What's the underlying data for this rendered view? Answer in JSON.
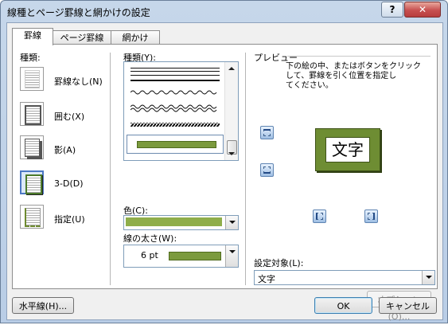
{
  "window": {
    "title": "線種とページ罫線と網かけの設定",
    "help": "?",
    "close": "✕"
  },
  "tabs": [
    "罫線",
    "ページ罫線",
    "網かけ"
  ],
  "setting": {
    "label": "種類:",
    "options": [
      "罫線なし(N)",
      "囲む(X)",
      "影(A)",
      "3-D(D)",
      "指定(U)"
    ],
    "selected": "3-D(D)"
  },
  "style": {
    "label": "種類(Y):"
  },
  "color": {
    "label": "色(C):",
    "value": "#8fae4a"
  },
  "width": {
    "label": "線の太さ(W):",
    "value": "6 pt",
    "swatch": "#7b9a3d"
  },
  "preview": {
    "label": "プレビュー",
    "instructions": [
      "下の絵の中、またはボタンをクリック",
      "して、罫線を引く位置を指定し",
      "てください。"
    ],
    "sample_text": "文字",
    "frame_color": "#6e8d33"
  },
  "apply_to": {
    "label": "設定対象(L):",
    "value": "文字"
  },
  "buttons": {
    "options": "オプション(O)...",
    "horizontal": "水平線(H)...",
    "ok": "OK",
    "cancel": "キャンセル"
  }
}
